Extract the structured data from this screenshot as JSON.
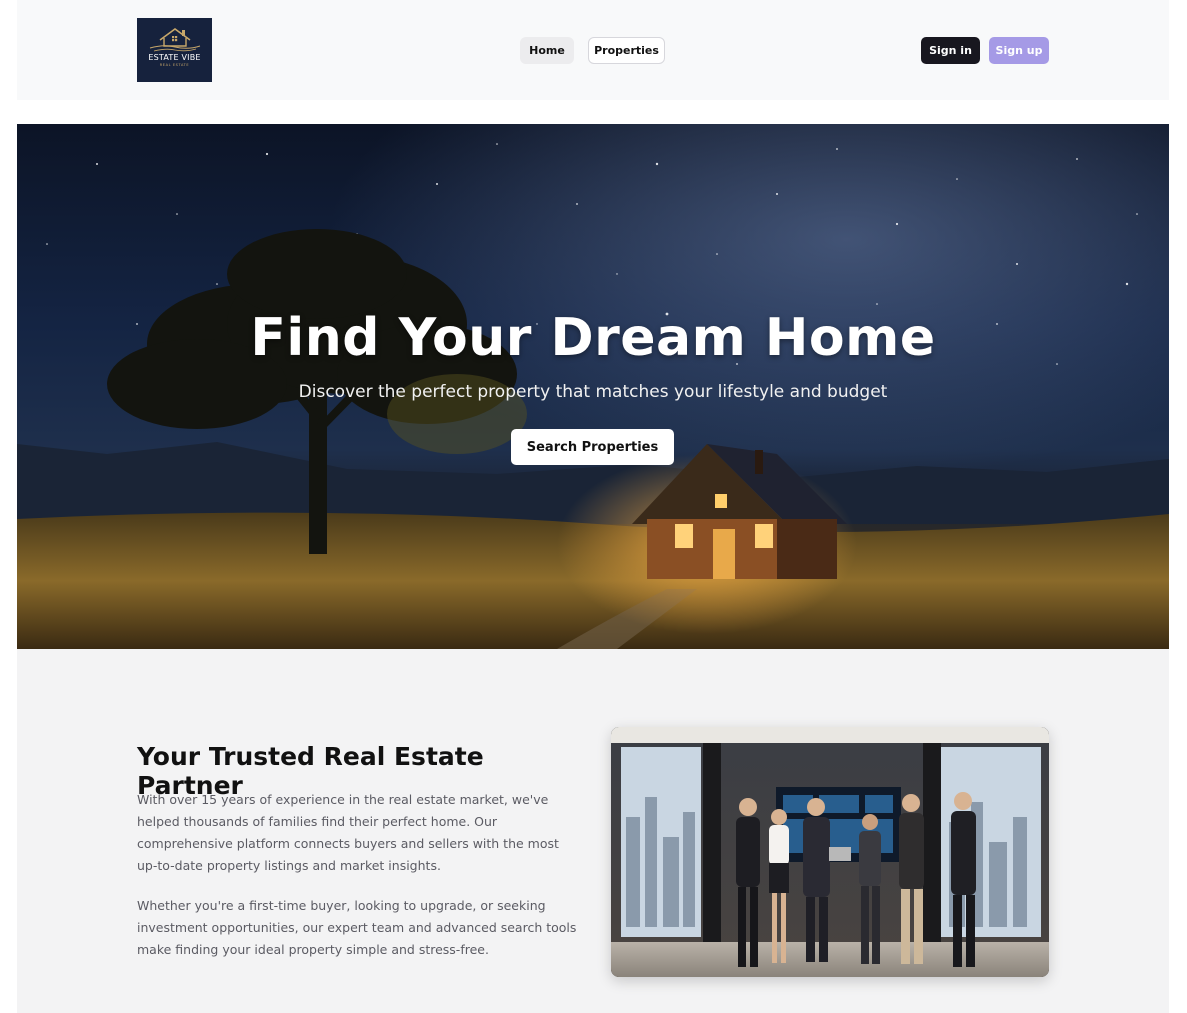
{
  "header": {
    "logo": {
      "title": "ESTATE VIBE",
      "subtitle": "REAL ESTATE",
      "icon": "house-logo-icon",
      "bg_color": "#16223d",
      "accent_color": "#c7a76a"
    },
    "nav": [
      {
        "label": "Home",
        "active": true
      },
      {
        "label": "Properties",
        "active": false
      }
    ],
    "auth": {
      "signin_label": "Sign in",
      "signup_label": "Sign up",
      "signin_color": "#18171f",
      "signup_color": "#a59ae6"
    }
  },
  "hero": {
    "title": "Find Your Dream Home",
    "subtitle": "Discover the perfect property that matches your lifestyle and budget",
    "cta_label": "Search Properties",
    "image": "night-sky-cabin-tree"
  },
  "about": {
    "title": "Your Trusted Real Estate Partner",
    "paragraphs": [
      "With over 15 years of experience in the real estate market, we've helped thousands of families find their perfect home. Our comprehensive platform connects buyers and sellers with the most up-to-date property listings and market insights.",
      "Whether you're a first-time buyer, looking to upgrade, or seeking investment opportunities, our expert team and advanced search tools make finding your ideal property simple and stress-free."
    ],
    "image": "team-meeting-office"
  }
}
